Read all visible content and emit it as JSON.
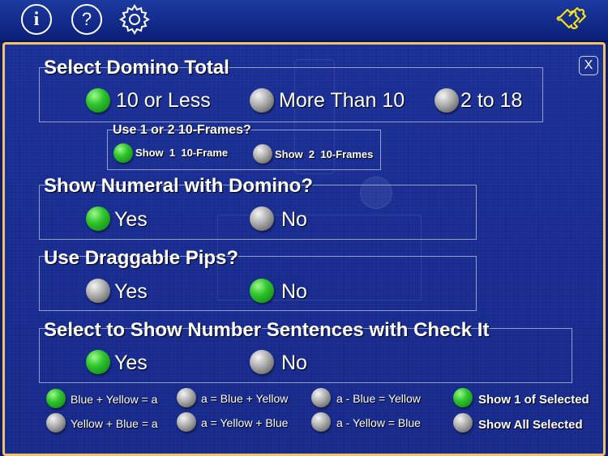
{
  "toolbar": {
    "info_label": "i",
    "help_label": "?",
    "settings_icon": "gear-icon",
    "puzzle_icon": "puzzle-icon"
  },
  "close_label": "X",
  "domino_total": {
    "title": "Select Domino Total",
    "options": [
      "10 or Less",
      "More Than 10",
      "2 to 18"
    ],
    "selected": "10 or Less"
  },
  "ten_frames": {
    "title": "Use 1 or 2 10-Frames?",
    "options": [
      "Show  1  10-Frame",
      "Show  2  10-Frames"
    ],
    "selected": "Show  1  10-Frame"
  },
  "show_numeral": {
    "title": "Show Numeral with Domino?",
    "options": [
      "Yes",
      "No"
    ],
    "selected": "Yes"
  },
  "draggable_pips": {
    "title": "Use Draggable Pips?",
    "options": [
      "Yes",
      "No"
    ],
    "selected": "No"
  },
  "number_sentences": {
    "title": "Select to Show Number Sentences with Check It",
    "options": [
      "Yes",
      "No"
    ],
    "selected": "Yes"
  },
  "sentences": {
    "row1": [
      "Blue + Yellow = a",
      "a = Blue + Yellow",
      "a - Blue = Yellow",
      "Show 1 of Selected"
    ],
    "row2": [
      "Yellow + Blue = a",
      "a = Yellow + Blue",
      "a - Yellow = Blue",
      "Show All Selected"
    ]
  },
  "colors": {
    "background": "#0d1c6e",
    "panel_border": "#f2c26a",
    "selected": "#2fc42d",
    "unselected": "#a9a9a9"
  }
}
